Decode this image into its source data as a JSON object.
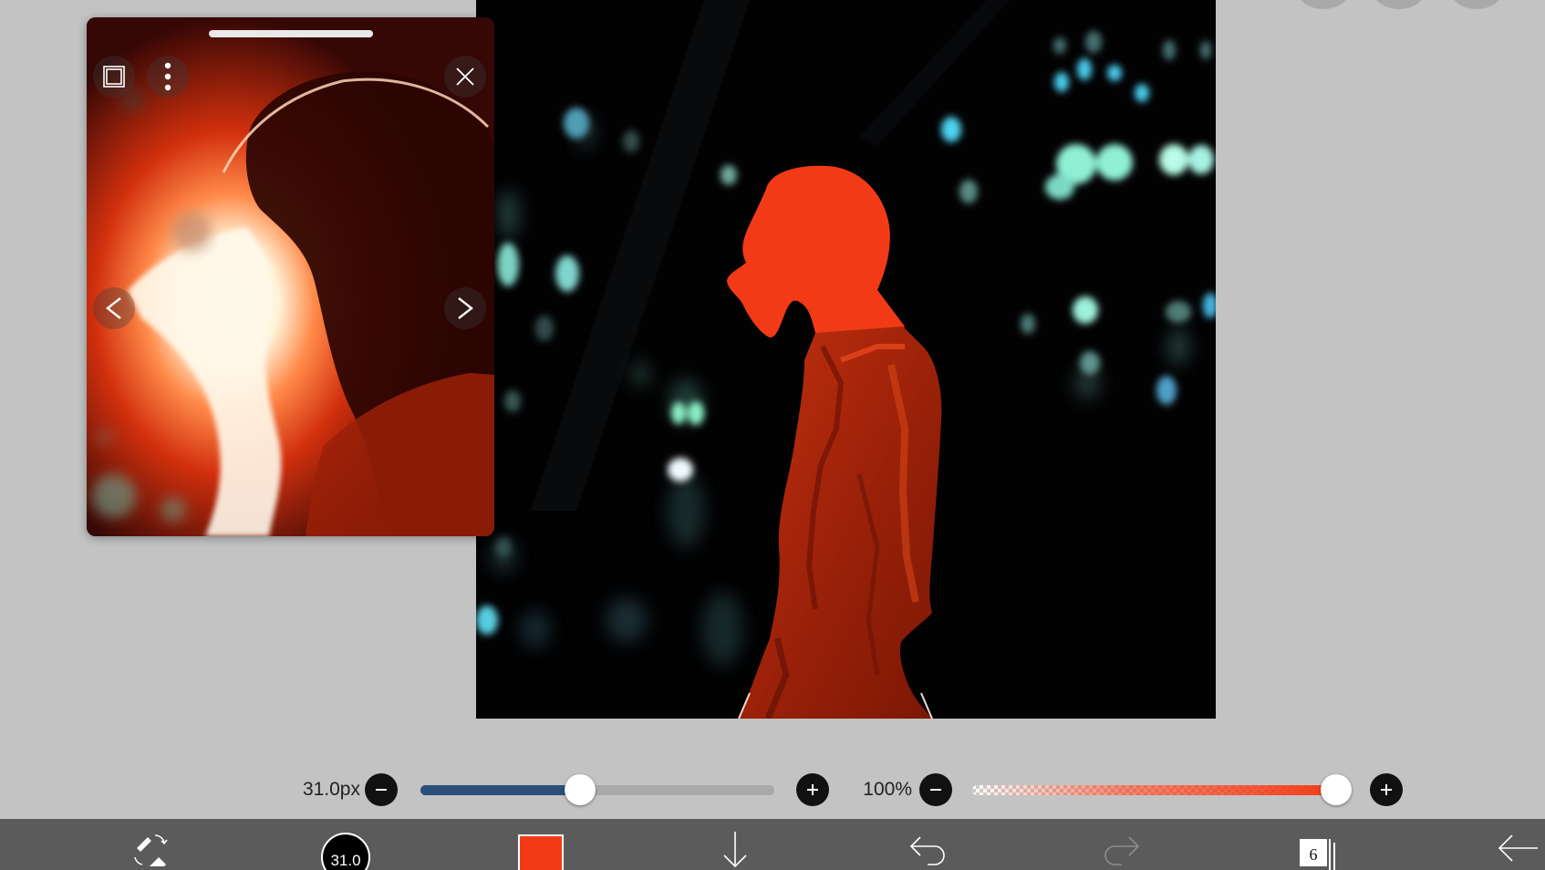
{
  "brush": {
    "size_label": "31.0px",
    "size_value": 31.0,
    "size_slider_fraction": 0.45,
    "opacity_label": "100%",
    "opacity_value": 100,
    "indicator_label": "31.0"
  },
  "toolbar": {
    "color": "#f23b16",
    "layer_count": "6"
  },
  "colors": {
    "background": "#c3c3c3",
    "toolbar": "#5b5b5b",
    "size_track_fill": "#2b4f78",
    "accent": "#f23b16",
    "canvas": "#020203"
  },
  "icons": {
    "ref_frame": "square-frame-icon",
    "ref_menu": "more-vertical-icon",
    "ref_close": "close-icon",
    "ref_prev": "chevron-left-icon",
    "ref_next": "chevron-right-icon",
    "tool_swap": "brush-eraser-swap-icon",
    "download": "arrow-down-icon",
    "undo": "undo-icon",
    "redo": "redo-icon",
    "layers": "layers-icon",
    "back": "arrow-left-icon"
  }
}
